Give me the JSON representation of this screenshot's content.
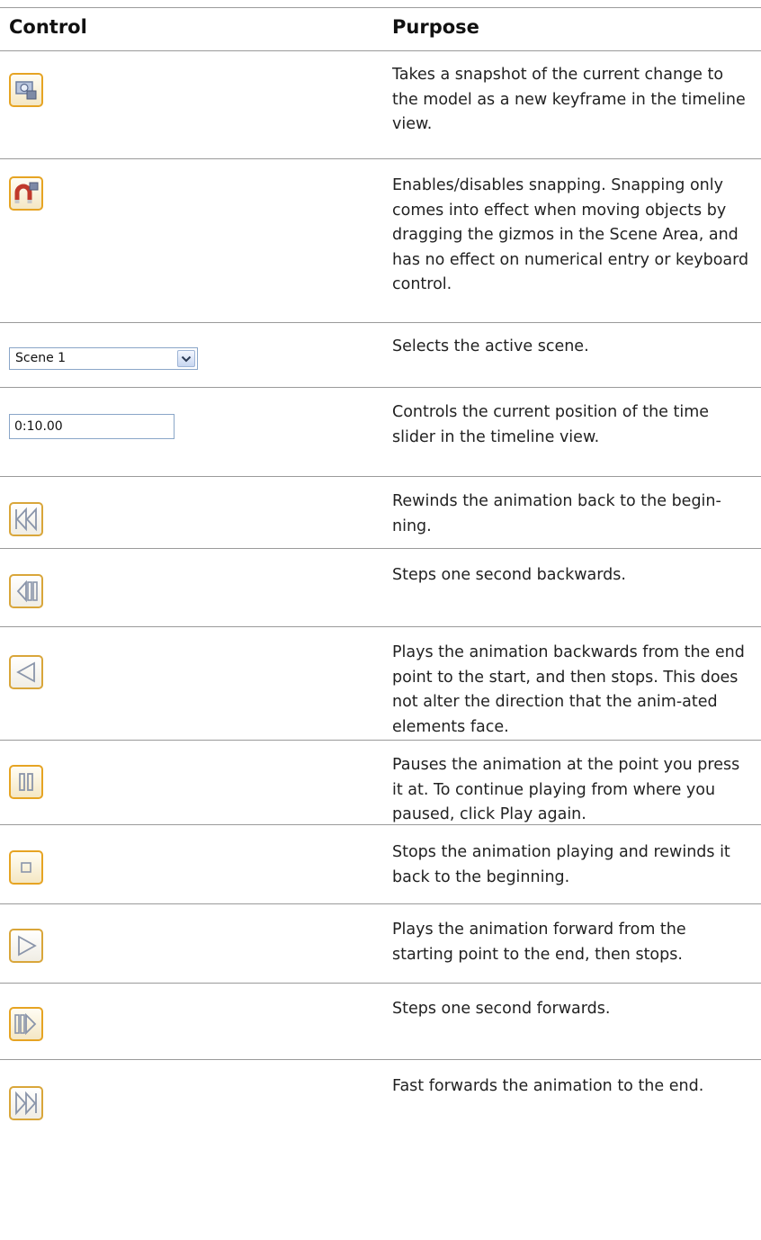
{
  "table": {
    "headers": {
      "control": "Control",
      "purpose": "Purpose"
    },
    "rows": [
      {
        "control_icon": "snapshot-keyframe-icon",
        "purpose": "Takes a snapshot of the current change to the model as a new keyframe in the timeline view."
      },
      {
        "control_icon": "snapping-magnet-icon",
        "purpose": "Enables/disables snapping. Snapping only comes into effect when moving objects by dragging the gizmos in the Scene Area, and has no effect on numerical entry or keyboard control."
      },
      {
        "control_select_value": "Scene 1",
        "purpose": "Selects the active scene."
      },
      {
        "control_input_value": "0:10.00",
        "purpose": "Controls the current position of the time slider in the timeline view."
      },
      {
        "control_icon": "rewind-icon",
        "purpose": "Rewinds the animation back to the begin-ning."
      },
      {
        "control_icon": "step-back-icon",
        "purpose": "Steps one second backwards."
      },
      {
        "control_icon": "play-backwards-icon",
        "purpose": "Plays the animation backwards from the end point to the start, and then stops. This does not alter the direction that the anim-ated elements face."
      },
      {
        "control_icon": "pause-icon",
        "purpose": "Pauses the animation at the point you press it at. To continue playing from where you paused, click Play again."
      },
      {
        "control_icon": "stop-icon",
        "purpose": "Stops the animation playing and rewinds it back to the beginning."
      },
      {
        "control_icon": "play-icon",
        "purpose": "Plays the animation forward from the starting point to the end, then stops."
      },
      {
        "control_icon": "step-forward-icon",
        "purpose": "Steps one second forwards."
      },
      {
        "control_icon": "fast-forward-icon",
        "purpose": "Fast forwards the animation to the end."
      }
    ]
  },
  "colors": {
    "button_border": "#e6a423",
    "rule": "#9a9a9a",
    "icon_stroke": "#8a95aa"
  }
}
